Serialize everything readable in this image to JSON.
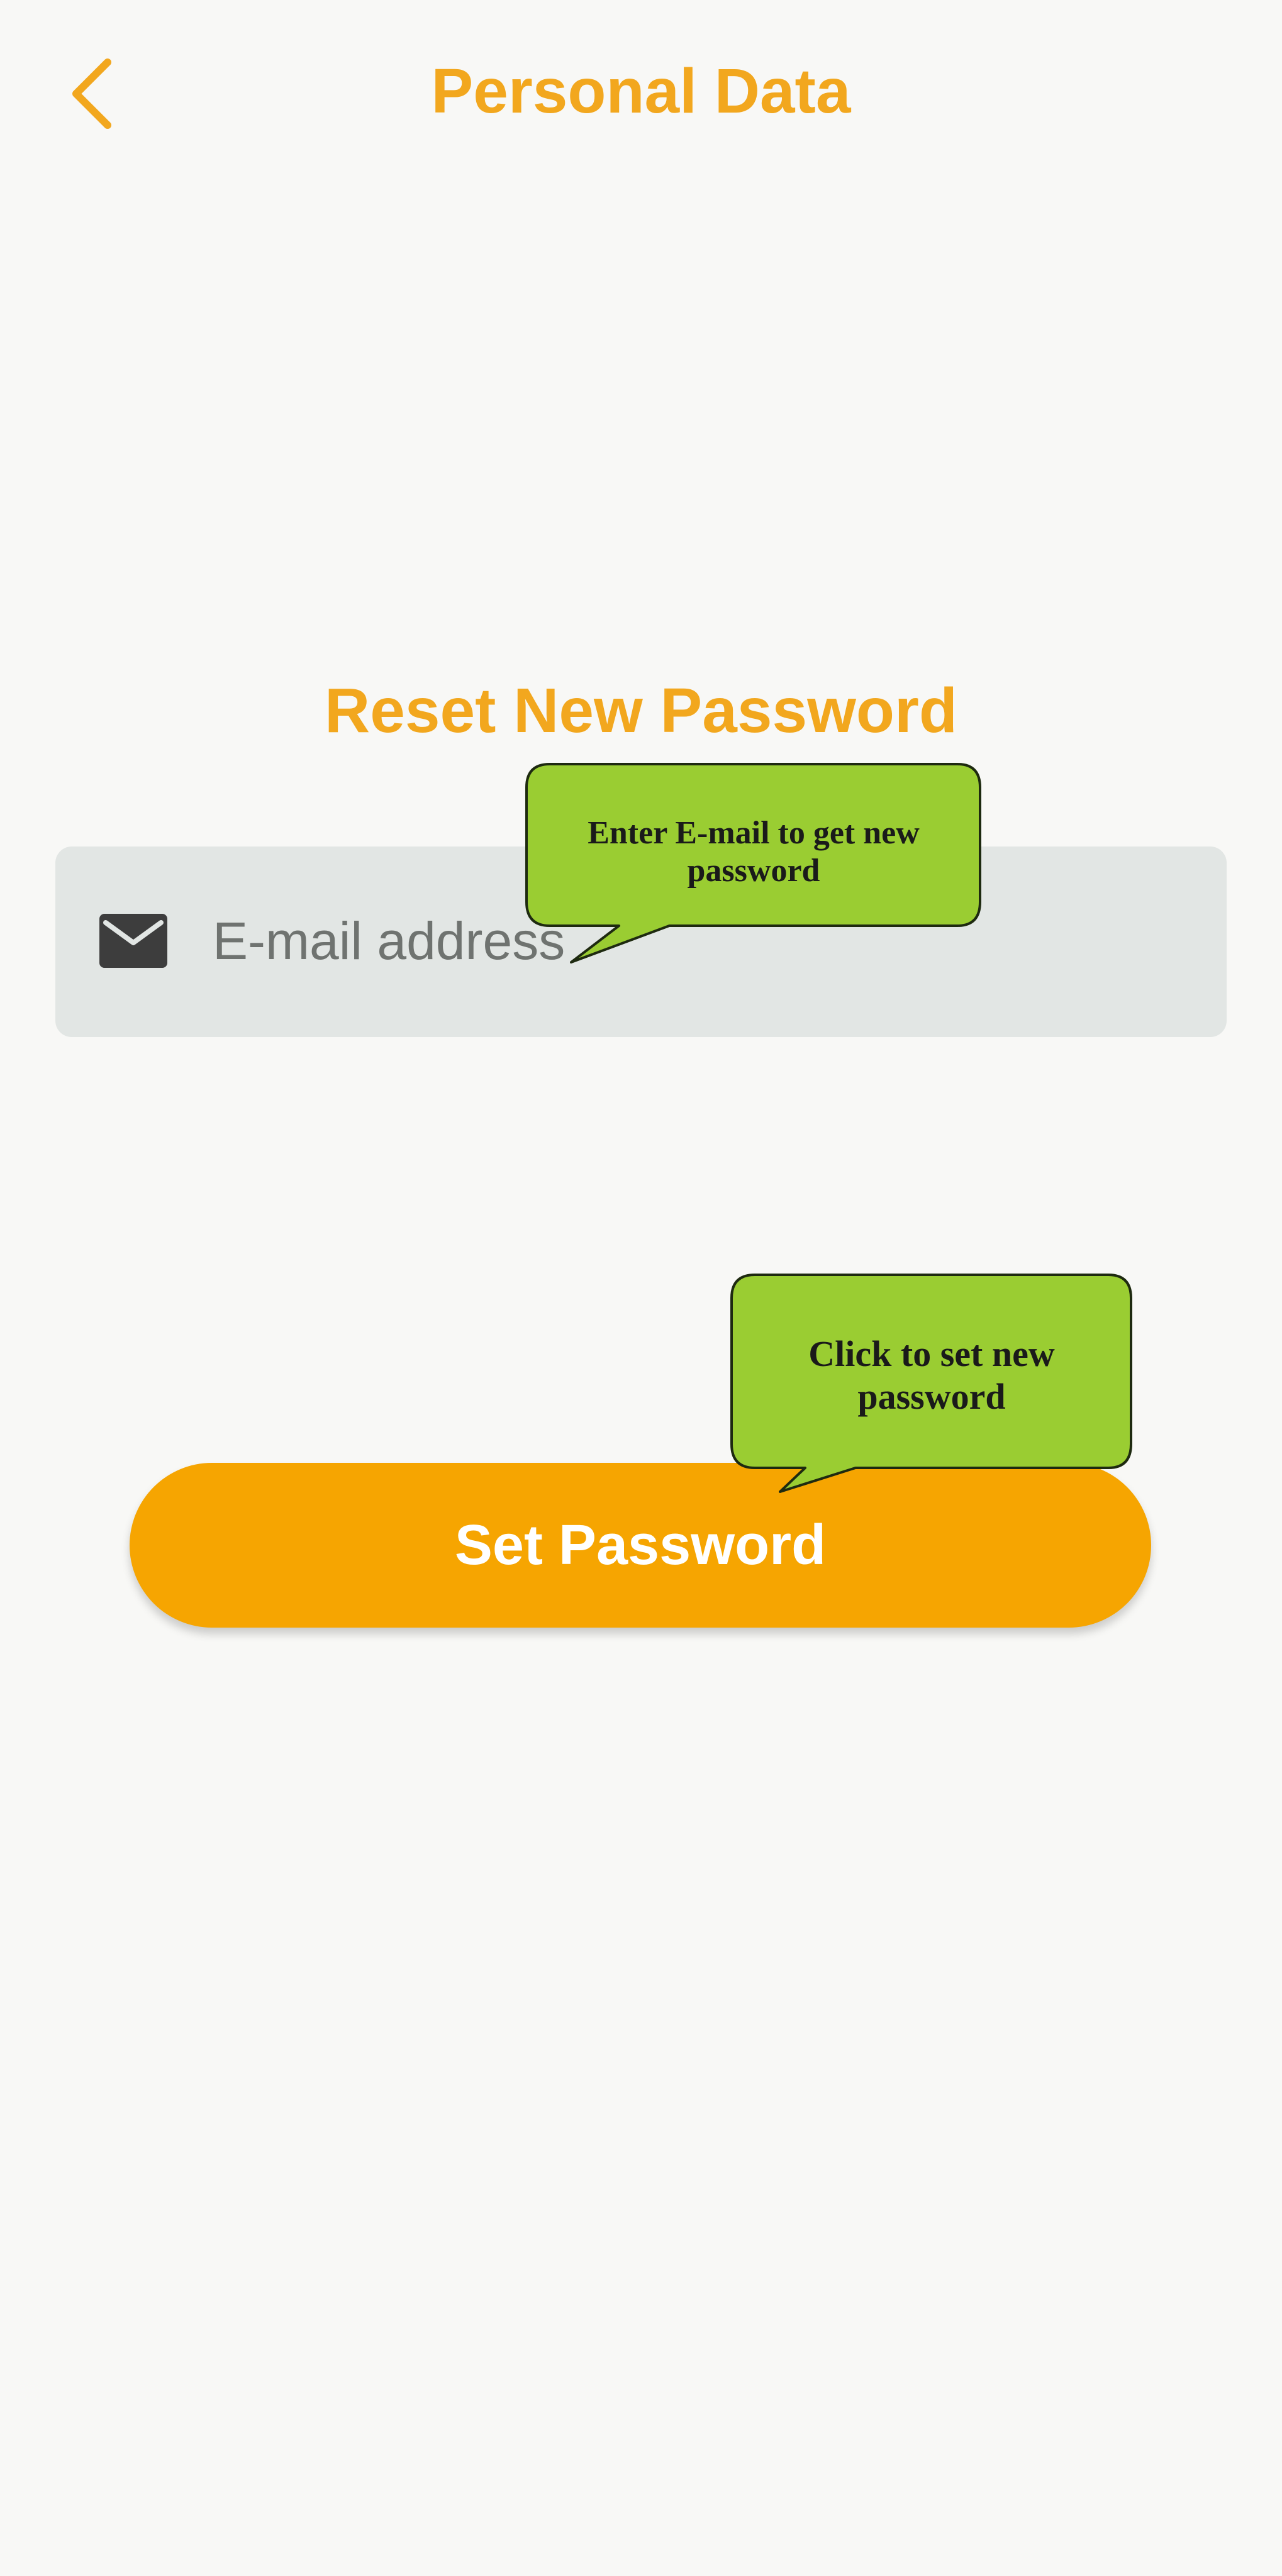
{
  "header": {
    "title": "Personal Data",
    "back_icon": "chevron-left-icon"
  },
  "section": {
    "title": "Reset New Password"
  },
  "email_field": {
    "icon": "mail-icon",
    "placeholder": "E-mail address",
    "value": ""
  },
  "set_password_button": {
    "label": "Set Password"
  },
  "callouts": {
    "email_hint": "Enter E-mail to get new password",
    "button_hint": "Click to set new password"
  },
  "colors": {
    "accent": "#f2a71e",
    "button": "#f6a501",
    "field_background": "#e2e6e4",
    "callout": "#9acd32",
    "background": "#f8f8f6"
  }
}
